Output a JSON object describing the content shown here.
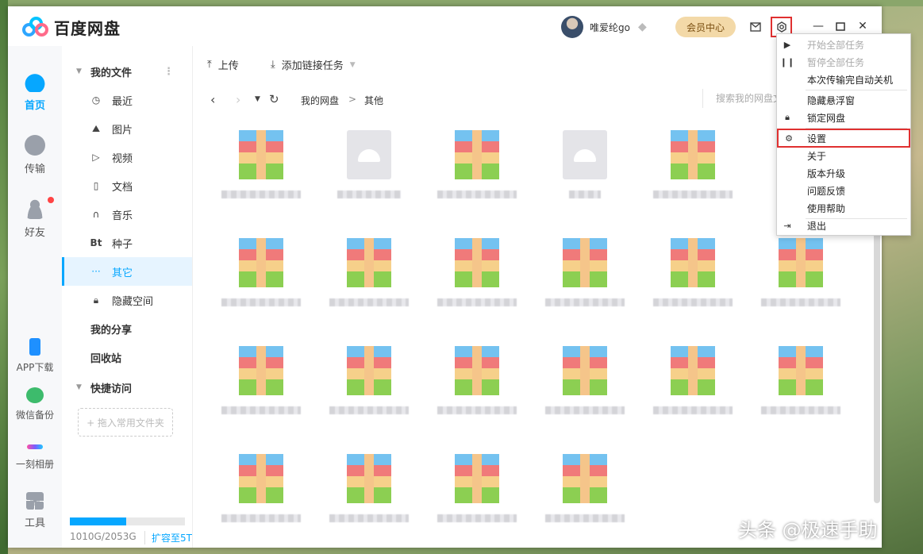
{
  "app": {
    "name": "百度网盘"
  },
  "header": {
    "username": "唯爱纶go",
    "vip_label": "会员中心"
  },
  "rail": [
    {
      "label": "首页",
      "icon": "cloud-icon"
    },
    {
      "label": "传输",
      "icon": "transfer-icon"
    },
    {
      "label": "好友",
      "icon": "friends-icon"
    },
    {
      "label": "APP下载",
      "icon": "phone-icon"
    },
    {
      "label": "微信备份",
      "icon": "wechat-icon"
    },
    {
      "label": "一刻相册",
      "icon": "album-icon"
    },
    {
      "label": "工具",
      "icon": "tools-icon"
    }
  ],
  "sidebar": {
    "my_files": "我的文件",
    "items": [
      "最近",
      "图片",
      "视频",
      "文档",
      "音乐",
      "种子",
      "其它",
      "隐藏空间"
    ],
    "bt_glyph": "Bt",
    "my_share": "我的分享",
    "recycle": "回收站",
    "quick_access": "快捷访问",
    "add_folder": "+ 拖入常用文件夹",
    "quota_text": "1010G/2053G",
    "quota_fraction": 0.49,
    "expand_link": "扩容至5T"
  },
  "toolbar": {
    "upload": "上传",
    "add_link": "添加链接任务"
  },
  "breadcrumb": {
    "root": "我的网盘",
    "sep": ">",
    "current": "其他"
  },
  "search": {
    "placeholder": "搜索我的网盘文件"
  },
  "menu": {
    "items": [
      "开始全部任务",
      "暂停全部任务",
      "本次传输完自动关机",
      "隐藏悬浮窗",
      "锁定网盘",
      "设置",
      "关于",
      "版本升级",
      "问题反馈",
      "使用帮助",
      "退出"
    ]
  },
  "watermark": "头条 @极速手助"
}
